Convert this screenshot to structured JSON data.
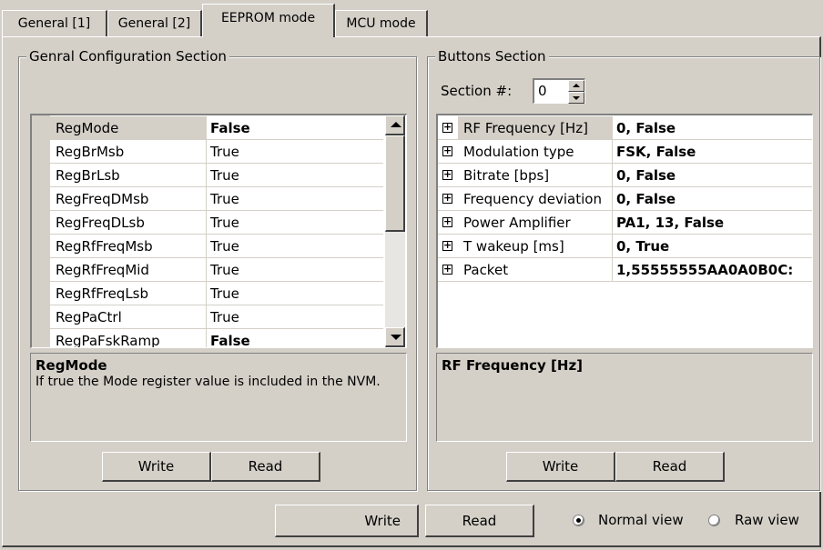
{
  "tabs": [
    {
      "label": "General [1]",
      "active": false
    },
    {
      "label": "General [2]",
      "active": false
    },
    {
      "label": "EEPROM mode",
      "active": true
    },
    {
      "label": "MCU mode",
      "active": false
    }
  ],
  "general_section": {
    "title": "Genral Configuration Section",
    "rows": [
      {
        "name": "RegMode",
        "value": "False",
        "bold": true
      },
      {
        "name": "RegBrMsb",
        "value": "True",
        "bold": false
      },
      {
        "name": "RegBrLsb",
        "value": "True",
        "bold": false
      },
      {
        "name": "RegFreqDMsb",
        "value": "True",
        "bold": false
      },
      {
        "name": "RegFreqDLsb",
        "value": "True",
        "bold": false
      },
      {
        "name": "RegRfFreqMsb",
        "value": "True",
        "bold": false
      },
      {
        "name": "RegRfFreqMid",
        "value": "True",
        "bold": false
      },
      {
        "name": "RegRfFreqLsb",
        "value": "True",
        "bold": false
      },
      {
        "name": "RegPaCtrl",
        "value": "True",
        "bold": false
      },
      {
        "name": "RegPaFskRamp",
        "value": "False",
        "bold": true
      }
    ],
    "description_title": "RegMode",
    "description_text": "If true the Mode register value is included in the NVM.",
    "write_label": "Write",
    "read_label": "Read"
  },
  "buttons_section": {
    "title": "Buttons Section",
    "section_label": "Section #:",
    "section_value": "0",
    "rows": [
      {
        "name": "RF Frequency [Hz]",
        "value": "0, False"
      },
      {
        "name": "Modulation type",
        "value": "FSK, False"
      },
      {
        "name": "Bitrate [bps]",
        "value": "0, False"
      },
      {
        "name": "Frequency deviation",
        "value": "0, False"
      },
      {
        "name": "Power Amplifier",
        "value": "PA1, 13, False"
      },
      {
        "name": "T wakeup [ms]",
        "value": "0, True"
      },
      {
        "name": "Packet",
        "value": "1,55555555AA0A0B0C:"
      }
    ],
    "expander_symbol": "+",
    "description_title": "RF Frequency [Hz]",
    "write_label": "Write",
    "read_label": "Read"
  },
  "footer": {
    "write_label": "Write",
    "read_label": "Read",
    "normal_view_label": "Normal view",
    "raw_view_label": "Raw view",
    "selected_view": "normal"
  }
}
